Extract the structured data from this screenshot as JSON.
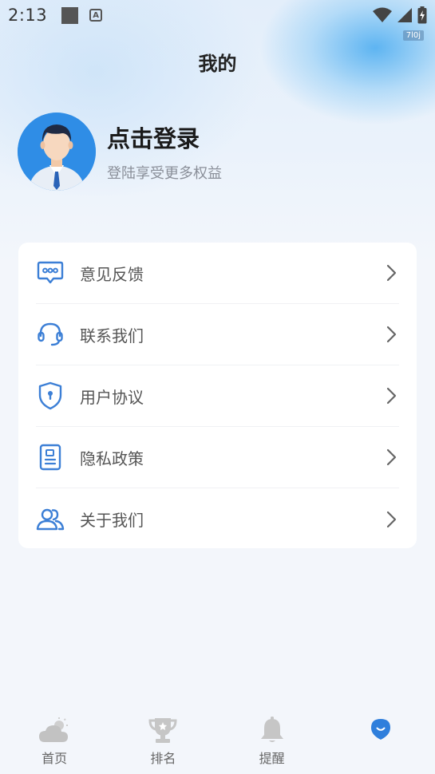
{
  "status_bar": {
    "time": "2:13",
    "badge": "7l0j"
  },
  "header": {
    "title": "我的"
  },
  "profile": {
    "login_title": "点击登录",
    "login_subtitle": "登陆享受更多权益"
  },
  "menu": {
    "items": [
      {
        "label": "意见反馈",
        "icon": "feedback-chat-icon"
      },
      {
        "label": "联系我们",
        "icon": "headset-icon"
      },
      {
        "label": "用户协议",
        "icon": "shield-keyhole-icon"
      },
      {
        "label": "隐私政策",
        "icon": "document-icon"
      },
      {
        "label": "关于我们",
        "icon": "people-icon"
      }
    ]
  },
  "bottom_nav": {
    "items": [
      {
        "label": "首页",
        "icon": "cloud-sun-icon"
      },
      {
        "label": "排名",
        "icon": "trophy-icon"
      },
      {
        "label": "提醒",
        "icon": "bell-icon"
      },
      {
        "label": "",
        "icon": "profile-smile-icon"
      }
    ]
  },
  "colors": {
    "accent": "#2f7fdc",
    "icon_blue": "#3c7fd6",
    "nav_gray": "#c8c8c8"
  }
}
